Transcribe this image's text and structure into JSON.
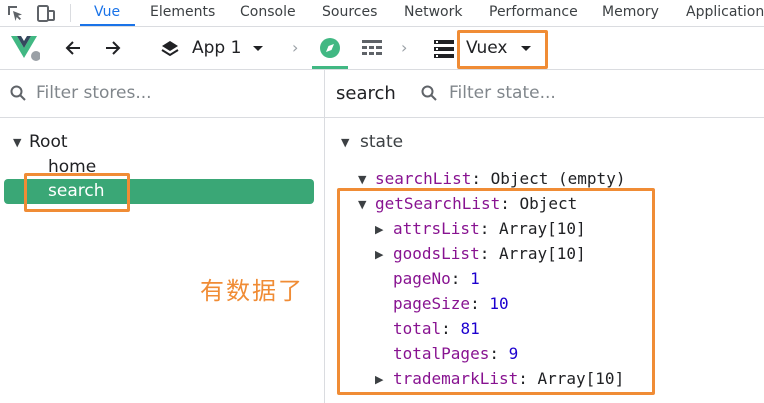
{
  "devtools_tabs": [
    "Vue",
    "Elements",
    "Console",
    "Sources",
    "Network",
    "Performance",
    "Memory",
    "Application"
  ],
  "active_tab": "Vue",
  "toolbar": {
    "app_name": "App 1",
    "store_mode": "Vuex"
  },
  "left": {
    "filter_placeholder": "Filter stores...",
    "tree": {
      "root": "Root",
      "children": [
        "home",
        "search"
      ],
      "selected": "search"
    }
  },
  "right": {
    "module_label": "search",
    "filter_placeholder": "Filter state...",
    "section": "state",
    "items": {
      "searchList_key": "searchList",
      "searchList_val": "Object (empty)",
      "getSearchList_key": "getSearchList",
      "getSearchList_val": "Object",
      "attrsList_key": "attrsList",
      "attrsList_val": "Array[10]",
      "goodsList_key": "goodsList",
      "goodsList_val": "Array[10]",
      "pageNo_key": "pageNo",
      "pageNo_val": "1",
      "pageSize_key": "pageSize",
      "pageSize_val": "10",
      "total_key": "total",
      "total_val": "81",
      "totalPages_key": "totalPages",
      "totalPages_val": "9",
      "trademarkList_key": "trademarkList",
      "trademarkList_val": "Array[10]"
    }
  },
  "annotation": "有数据了",
  "colors": {
    "accent": "#1a73e8",
    "vue_green": "#41b883",
    "selected_row": "#3aa776",
    "highlight_box": "#f08c35",
    "key_purple": "#881391",
    "number_blue": "#1c00cf"
  }
}
